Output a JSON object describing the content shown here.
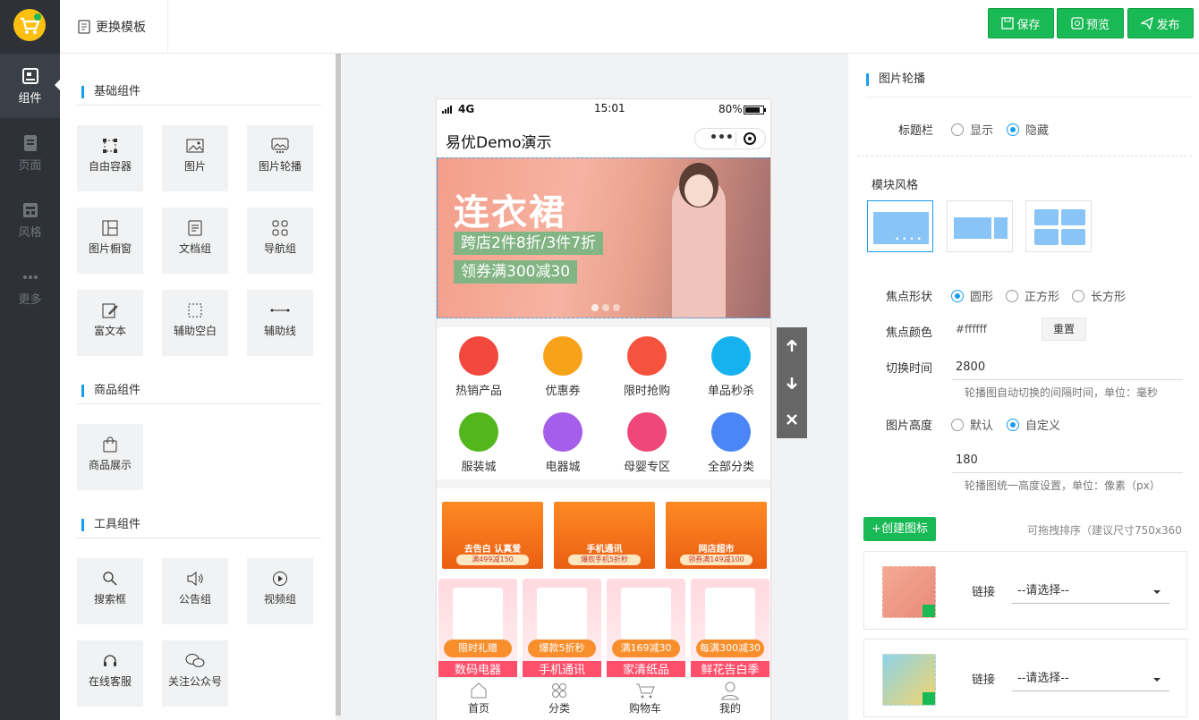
{
  "sidebar": {
    "items": [
      {
        "label": "组件"
      },
      {
        "label": "页面"
      },
      {
        "label": "风格"
      },
      {
        "label": "更多"
      }
    ]
  },
  "topbar": {
    "template_label": "更换模板",
    "save_label": "保存",
    "preview_label": "预览",
    "publish_label": "发布"
  },
  "components": {
    "basic_title": "基础组件",
    "basic": [
      "自由容器",
      "图片",
      "图片轮播",
      "图片橱窗",
      "文档组",
      "导航组",
      "富文本",
      "辅助空白",
      "辅助线"
    ],
    "goods_title": "商品组件",
    "goods": [
      "商品展示"
    ],
    "tools_title": "工具组件",
    "tools": [
      "搜索框",
      "公告组",
      "视频组",
      "在线客服",
      "关注公众号"
    ]
  },
  "phone": {
    "signal": "4G",
    "time": "15:01",
    "battery": "80%",
    "app_title": "易优Demo演示",
    "banner": {
      "headline": "连衣裙",
      "line1": "跨店2件8折/3件7折",
      "line2": "领券满300减30"
    },
    "nav_icons": [
      {
        "label": "热销产品",
        "color": "#f2483d"
      },
      {
        "label": "优惠券",
        "color": "#f7a319"
      },
      {
        "label": "限时抢购",
        "color": "#f5533d"
      },
      {
        "label": "单品秒杀",
        "color": "#16b2f0"
      },
      {
        "label": "服装城",
        "color": "#51b71c"
      },
      {
        "label": "电器城",
        "color": "#a55ee9"
      },
      {
        "label": "母婴专区",
        "color": "#ef4779"
      },
      {
        "label": "全部分类",
        "color": "#4a86f5"
      }
    ],
    "promos": [
      {
        "title": "去告白 认真爱",
        "sub": "满499减150"
      },
      {
        "title": "手机通讯",
        "sub": "爆款手机5折秒"
      },
      {
        "title": "网店超市",
        "sub": "领券满149减100"
      }
    ],
    "promos2": [
      {
        "tag": "限时礼赠",
        "title": "数码电器"
      },
      {
        "tag": "爆款5折秒",
        "title": "手机通讯"
      },
      {
        "tag": "满169减30",
        "title": "家清纸品"
      },
      {
        "tag": "每满300减30",
        "title": "鲜花告白季"
      }
    ],
    "tabs": [
      "首页",
      "分类",
      "购物车",
      "我的"
    ]
  },
  "settings": {
    "panel_title": "图片轮播",
    "title_bar_label": "标题栏",
    "title_bar_options": [
      "显示",
      "隐藏"
    ],
    "title_bar_selected": 1,
    "module_style_label": "模块风格",
    "focus_shape_label": "焦点形状",
    "focus_shape_options": [
      "圆形",
      "正方形",
      "长方形"
    ],
    "focus_color_label": "焦点颜色",
    "focus_color_value": "#ffffff",
    "reset_label": "重置",
    "switch_time_label": "切换时间",
    "switch_time_value": "2800",
    "switch_time_hint": "轮播图自动切换的间隔时间，单位：毫秒",
    "img_height_label": "图片高度",
    "img_height_options": [
      "默认",
      "自定义"
    ],
    "img_height_value": "180",
    "img_height_hint": "轮播图统一高度设置，单位：像素（px）",
    "create_label": "+创建图标",
    "sort_hint": "可拖拽排序（建议尺寸750x360",
    "link_label": "链接",
    "select_placeholder": "--请选择--"
  }
}
